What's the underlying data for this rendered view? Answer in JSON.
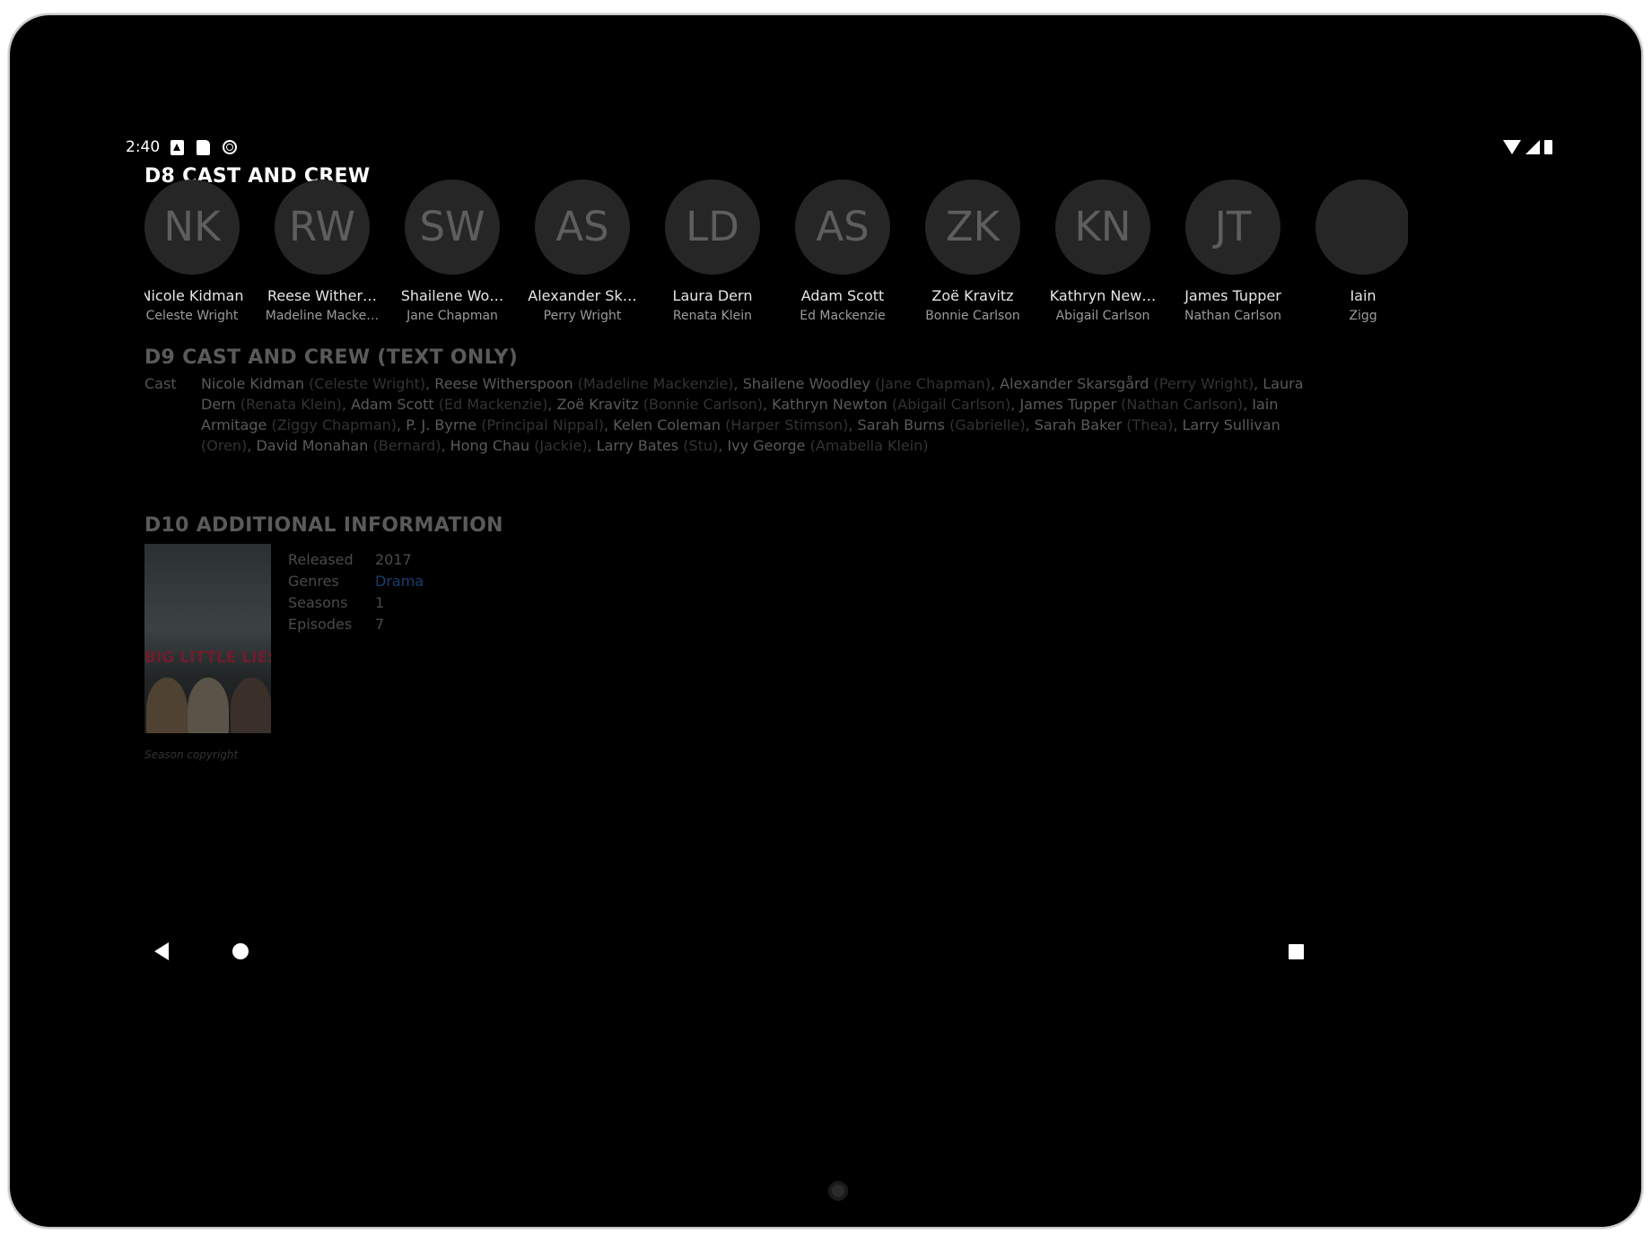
{
  "status_bar": {
    "time": "2:40"
  },
  "sections": {
    "cast_crew": {
      "title": "D8 CAST AND CREW"
    },
    "cast_text": {
      "title": "D9 CAST AND CREW (TEXT ONLY)",
      "label": "Cast"
    },
    "additional": {
      "title": "D10 ADDITIONAL INFORMATION"
    }
  },
  "cast": [
    {
      "initials": "NK",
      "name": "Nicole Kidman",
      "role": "Celeste Wright"
    },
    {
      "initials": "RW",
      "name": "Reese Wither…",
      "role": "Madeline Macke…"
    },
    {
      "initials": "SW",
      "name": "Shailene Wo…",
      "role": "Jane Chapman"
    },
    {
      "initials": "AS",
      "name": "Alexander Sk…",
      "role": "Perry Wright"
    },
    {
      "initials": "LD",
      "name": "Laura Dern",
      "role": "Renata Klein"
    },
    {
      "initials": "AS",
      "name": "Adam Scott",
      "role": "Ed Mackenzie"
    },
    {
      "initials": "ZK",
      "name": "Zoë Kravitz",
      "role": "Bonnie Carlson"
    },
    {
      "initials": "KN",
      "name": "Kathryn New…",
      "role": "Abigail Carlson"
    },
    {
      "initials": "JT",
      "name": "James Tupper",
      "role": "Nathan Carlson"
    },
    {
      "initials": "",
      "name": "Iain",
      "role": "Zigg"
    }
  ],
  "cast_text_entries": [
    {
      "name": "Nicole Kidman",
      "role": "(Celeste Wright)"
    },
    {
      "name": "Reese Witherspoon",
      "role": "(Madeline Mackenzie)"
    },
    {
      "name": "Shailene Woodley",
      "role": "(Jane Chapman)"
    },
    {
      "name": "Alexander Skarsgård",
      "role": "(Perry Wright)"
    },
    {
      "name": "Laura Dern",
      "role": "(Renata Klein)"
    },
    {
      "name": "Adam Scott",
      "role": "(Ed Mackenzie)"
    },
    {
      "name": "Zoë Kravitz",
      "role": "(Bonnie Carlson)"
    },
    {
      "name": "Kathryn Newton",
      "role": "(Abigail Carlson)"
    },
    {
      "name": "James Tupper",
      "role": "(Nathan Carlson)"
    },
    {
      "name": "Iain Armitage",
      "role": "(Ziggy Chapman)"
    },
    {
      "name": "P. J. Byrne",
      "role": "(Principal Nippal)"
    },
    {
      "name": "Kelen Coleman",
      "role": "(Harper Stimson)"
    },
    {
      "name": "Sarah Burns",
      "role": "(Gabrielle)"
    },
    {
      "name": "Sarah Baker",
      "role": "(Thea)"
    },
    {
      "name": "Larry Sullivan",
      "role": "(Oren)"
    },
    {
      "name": "David Monahan",
      "role": "(Bernard)"
    },
    {
      "name": "Hong Chau",
      "role": "(Jackie)"
    },
    {
      "name": "Larry Bates",
      "role": "(Stu)"
    },
    {
      "name": "Ivy George",
      "role": "(Amabella Klein)"
    }
  ],
  "poster": {
    "title": "BIG LITTLE LIES",
    "caption": "Season copyright"
  },
  "info": [
    {
      "label": "Released",
      "value": "2017",
      "link": false
    },
    {
      "label": "Genres",
      "value": "Drama",
      "link": true
    },
    {
      "label": "Seasons",
      "value": "1",
      "link": false
    },
    {
      "label": "Episodes",
      "value": "7",
      "link": false
    }
  ],
  "icons": {
    "status_left": [
      "photo-icon",
      "sd-card-icon",
      "sync-icon"
    ],
    "status_right": [
      "wifi-icon",
      "cell-signal-icon",
      "battery-icon"
    ],
    "nav": [
      "back-icon",
      "home-icon",
      "recents-icon"
    ]
  },
  "colors": {
    "link": "#1b3d6b",
    "avatar_bg": "#262626",
    "background": "#000000"
  }
}
